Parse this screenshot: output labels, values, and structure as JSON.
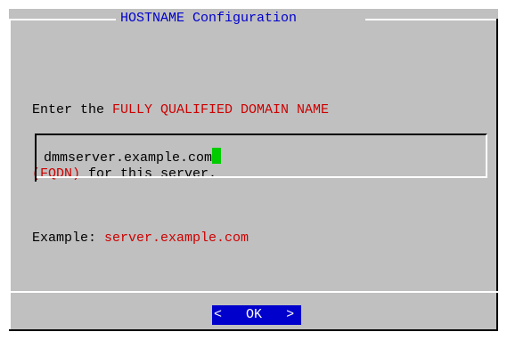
{
  "dialog": {
    "title": "HOSTNAME Configuration",
    "prompt": {
      "line1_prefix": "Enter the ",
      "line1_highlight": "FULLY QUALIFIED DOMAIN NAME",
      "line2_highlight": "(FQDN)",
      "line2_suffix": " for this server.",
      "line3_prefix": "Example: ",
      "line3_highlight": "server.example.com"
    },
    "input": {
      "value": "dmmserver.example.com"
    },
    "buttons": {
      "ok_left_bracket": "<",
      "ok_label": "OK",
      "ok_right_bracket": ">"
    }
  },
  "colors": {
    "background": "#c0c0c0",
    "title": "#0000cc",
    "highlight_text": "#cc0000",
    "cursor": "#00cc00",
    "button_bg": "#0000cc"
  }
}
